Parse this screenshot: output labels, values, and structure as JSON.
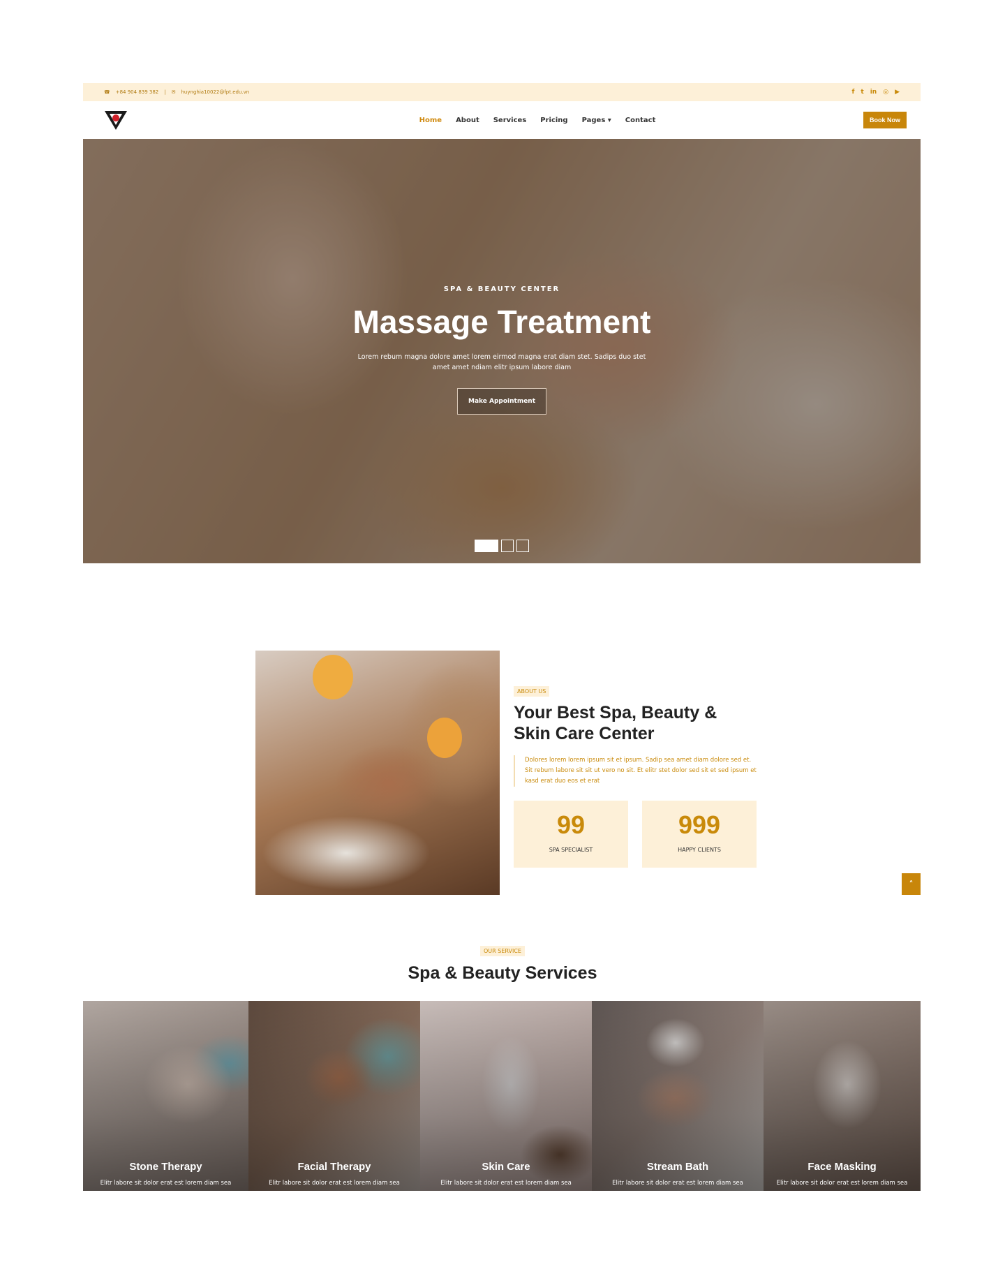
{
  "topbar": {
    "phone": "+84 904 839 382",
    "separator": "|",
    "email": "huynghia10022@fpt.edu.vn",
    "socials": [
      "facebook-icon",
      "twitter-icon",
      "linkedin-icon",
      "instagram-icon",
      "youtube-icon"
    ],
    "social_glyphs": [
      "f",
      "t",
      "in",
      "◎",
      "▶"
    ]
  },
  "nav": {
    "items": [
      "Home",
      "About",
      "Services",
      "Pricing",
      "Pages ▾",
      "Contact"
    ],
    "active": "Home",
    "cta": "Book Now"
  },
  "hero": {
    "eyebrow": "SPA & BEAUTY CENTER",
    "title": "Massage Treatment",
    "text": "Lorem rebum magna dolore amet lorem eirmod magna erat diam stet. Sadips duo stet amet amet ndiam elitr ipsum labore diam",
    "button": "Make Appointment",
    "slides": 3,
    "active_slide": 1
  },
  "about": {
    "tag": "ABOUT US",
    "title": "Your Best Spa, Beauty & Skin Care Center",
    "text": "Dolores lorem lorem ipsum sit et ipsum. Sadip sea amet diam dolore sed et. Sit rebum labore sit sit ut vero no sit. Et elitr stet dolor sed sit et sed ipsum et kasd erat duo eos et erat",
    "stats": [
      {
        "number": "99",
        "label": "SPA SPECIALIST"
      },
      {
        "number": "999",
        "label": "HAPPY CLIENTS"
      }
    ]
  },
  "scroll_top": "»",
  "services": {
    "tag": "OUR SERVICE",
    "title": "Spa & Beauty Services",
    "cards": [
      {
        "title": "Stone Therapy",
        "text": "Elitr labore sit dolor erat est lorem diam sea"
      },
      {
        "title": "Facial Therapy",
        "text": "Elitr labore sit dolor erat est lorem diam sea"
      },
      {
        "title": "Skin Care",
        "text": "Elitr labore sit dolor erat est lorem diam sea"
      },
      {
        "title": "Stream Bath",
        "text": "Elitr labore sit dolor erat est lorem diam sea"
      },
      {
        "title": "Face Masking",
        "text": "Elitr labore sit dolor erat est lorem diam sea"
      }
    ]
  },
  "colors": {
    "accent": "#c8860a",
    "cream": "#fdf0d8"
  }
}
